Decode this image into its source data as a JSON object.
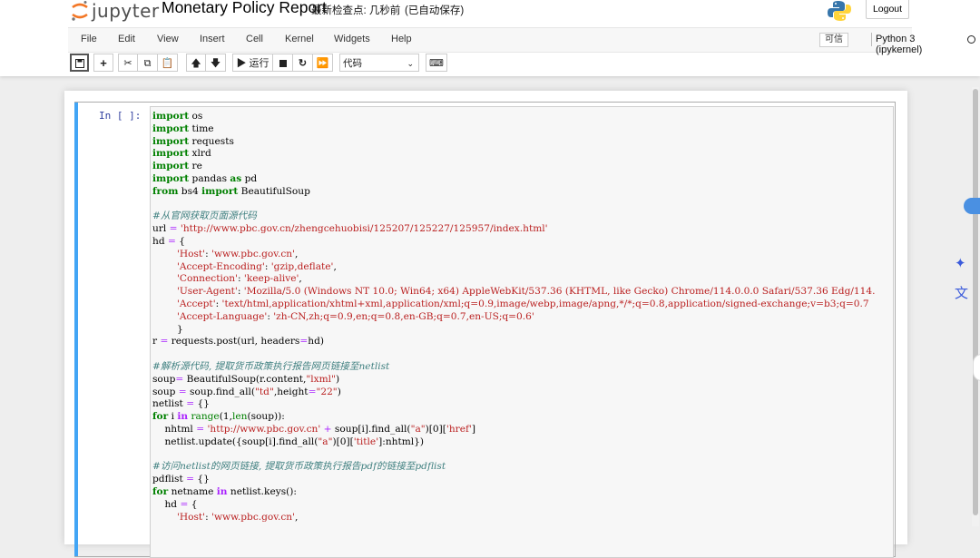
{
  "header": {
    "logo_text": "jupyter",
    "notebook_title": "Monetary Policy Report",
    "checkpoint": "最新检查点: 几秒前",
    "autosave": "(已自动保存)",
    "logout_label": "Logout"
  },
  "menubar": {
    "items": [
      "File",
      "Edit",
      "View",
      "Insert",
      "Cell",
      "Kernel",
      "Widgets",
      "Help"
    ],
    "trusted_label": "可信",
    "kernel_name": "Python 3 (ipykernel)"
  },
  "toolbar": {
    "run_label": "▶ 运行",
    "cell_type": "代码"
  },
  "cell": {
    "prompt": "In [ ]:"
  }
}
